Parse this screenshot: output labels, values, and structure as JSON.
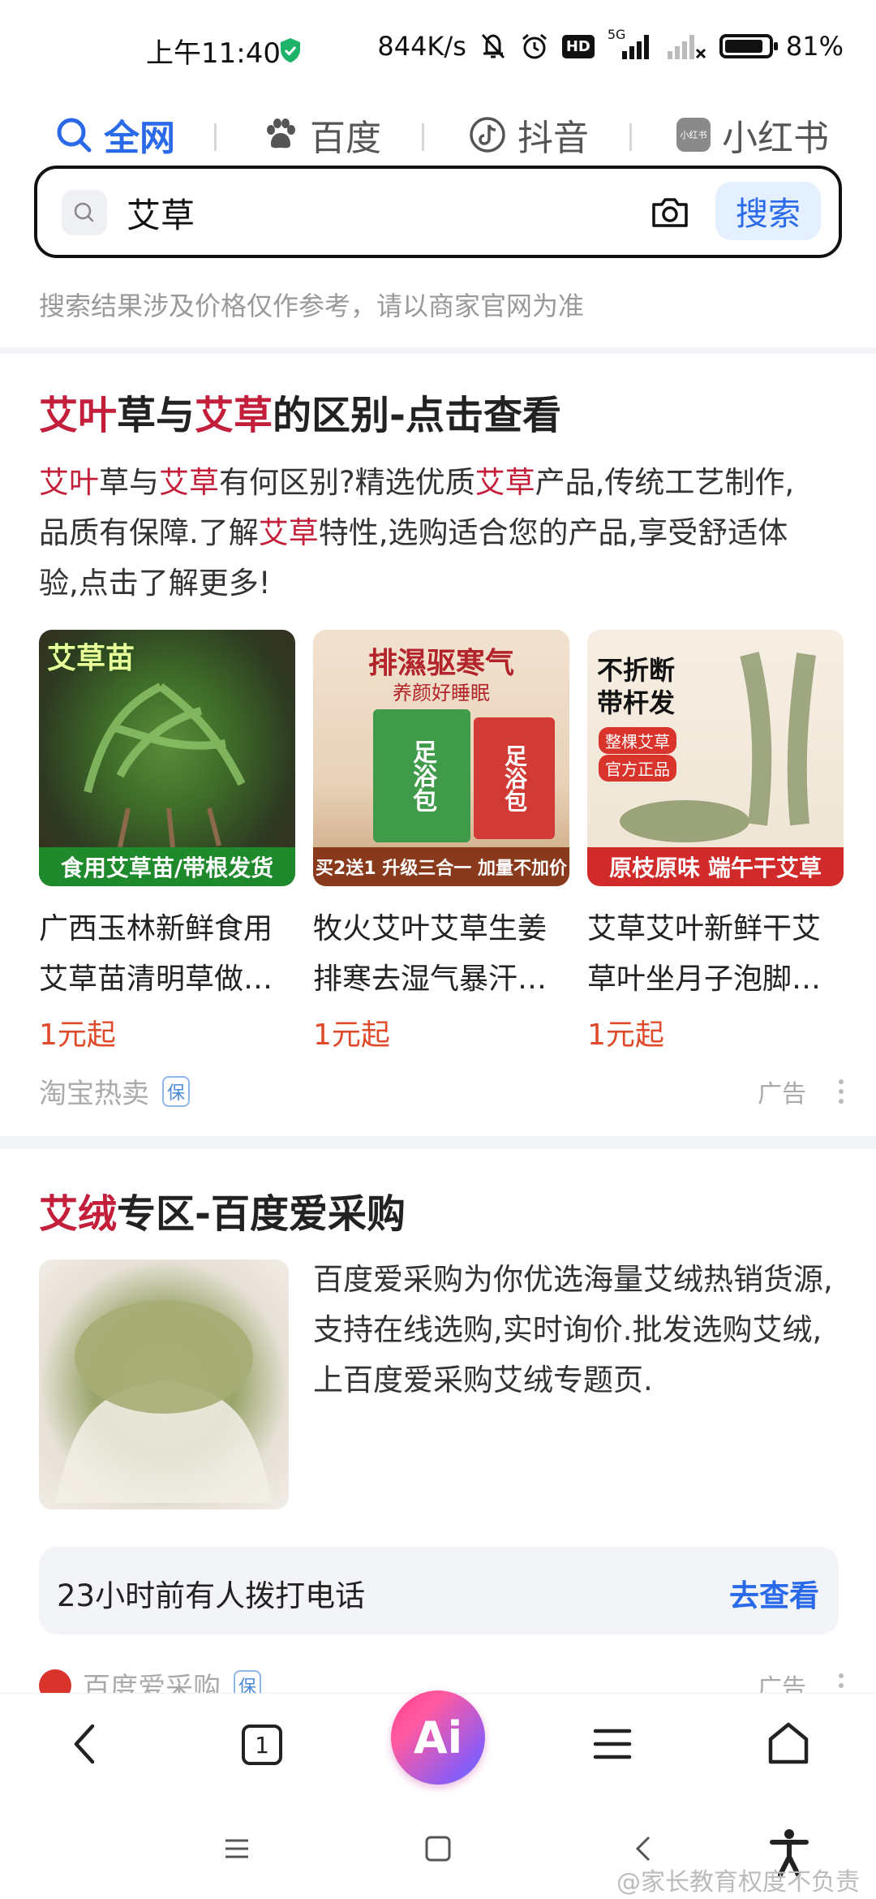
{
  "status_bar": {
    "time": "上午11:40",
    "network_speed": "844K/s",
    "signal_label": "5G",
    "hd_label": "HD",
    "battery": "81%"
  },
  "tabs": [
    {
      "label": "全网",
      "icon": "search-icon",
      "active": true
    },
    {
      "label": "百度",
      "icon": "paw-icon",
      "active": false
    },
    {
      "label": "抖音",
      "icon": "tiktok-icon",
      "active": false
    },
    {
      "label": "小红书",
      "icon": "xiaohongshu-icon",
      "icon_text": "小红书",
      "active": false
    }
  ],
  "search": {
    "query": "艾草",
    "button_label": "搜索"
  },
  "disclaimer": "搜索结果涉及价格仅作参考，请以商家官网为准",
  "result1": {
    "title_parts": [
      "艾叶",
      "草与",
      "艾草",
      "的区别-点击查看"
    ],
    "desc_line1_parts": [
      "艾叶",
      "草与",
      "艾草",
      "有何区别?精选优质",
      "艾草",
      "产品,传统工艺制作,"
    ],
    "desc_line2_parts": [
      "品质有保障.了解",
      "艾草",
      "特性,选购适合您的产品,享受舒适体"
    ],
    "desc_line3": "验,点击了解更多!",
    "products": [
      {
        "name": "广西玉林新鲜食用艾草苗清明草做…",
        "price": "1元起",
        "img_tag": "艾草苗",
        "img_banner": "食用艾草苗/带根发货"
      },
      {
        "name": "牧火艾叶艾草生姜排寒去湿气暴汗…",
        "price": "1元起",
        "img_title": "排濕驱寒气",
        "img_sub": "养颜好睡眠",
        "img_pack": "足浴包",
        "img_banner": "买2送1  升级三合一 加量不加价"
      },
      {
        "name": "艾草艾叶新鲜干艾草叶坐月子泡脚…",
        "price": "1元起",
        "img_title": "不折断\n带杆发",
        "img_badge1": "整棵艾草",
        "img_badge2": "官方正品",
        "img_banner": "原枝原味 端午干艾草"
      }
    ],
    "source": "淘宝热卖",
    "badge": "保",
    "ad": "广告"
  },
  "result2": {
    "title_parts": [
      "艾绒",
      "专区-百度爱采购"
    ],
    "desc": "百度爱采购为你优选海量艾绒热销货源,支持在线选购,实时询价.批发选购艾绒,上百度爱采购艾绒专题页.",
    "callout_text": "23小时前有人拨打电话",
    "callout_link": "去查看",
    "source": "百度爱采购",
    "badge": "保",
    "ad": "广告"
  },
  "bottom_nav": {
    "tab_count": "1",
    "ai_label": "Ai"
  },
  "watermark": "@家长教育权度不负责",
  "colors": {
    "accent": "#2a6ae9",
    "highlight": "#c41f3a",
    "price": "#e04a2a"
  }
}
